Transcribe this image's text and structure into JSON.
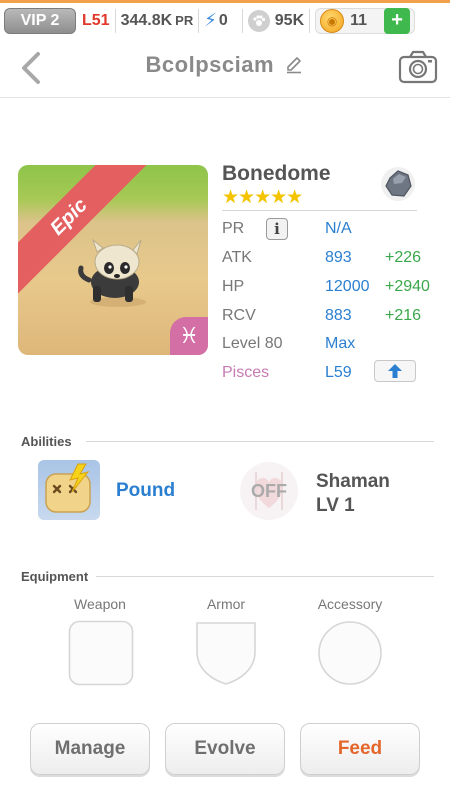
{
  "topbar": {
    "vip": "VIP 2",
    "level": "L51",
    "power": "344.8K",
    "power_unit": "PR",
    "energy": "0",
    "paw_currency": "95K",
    "coins": "11",
    "add_label": "+"
  },
  "header": {
    "title": "Bcolpsciam"
  },
  "pet": {
    "rarity": "Epic",
    "name": "Bonedome",
    "stars": "★★★★★",
    "zodiac_symbol": "♓",
    "stats": [
      {
        "label": "PR",
        "value": "N/A",
        "bonus": ""
      },
      {
        "label": "ATK",
        "value": "893",
        "bonus": "+226"
      },
      {
        "label": "HP",
        "value": "12000",
        "bonus": "+2940"
      },
      {
        "label": "RCV",
        "value": "883",
        "bonus": "+216"
      },
      {
        "label": "Level 80",
        "value": "Max",
        "bonus": ""
      },
      {
        "label": "Pisces",
        "value": "L59",
        "bonus": ""
      }
    ],
    "info_glyph": "i"
  },
  "abilities": {
    "title": "Abilities",
    "ability_name": "Pound",
    "passive_state": "OFF",
    "passive_name": "Shaman",
    "passive_level": "LV 1"
  },
  "equipment": {
    "title": "Equipment",
    "slots": [
      "Weapon",
      "Armor",
      "Accessory"
    ]
  },
  "actions": {
    "manage": "Manage",
    "evolve": "Evolve",
    "feed": "Feed"
  },
  "colors": {
    "accent_blue": "#2b7fd0",
    "bonus_green": "#3aa84a",
    "feed_orange": "#e4662a",
    "epic_ribbon": "#e46060",
    "zodiac_pink": "#d46fa6"
  }
}
